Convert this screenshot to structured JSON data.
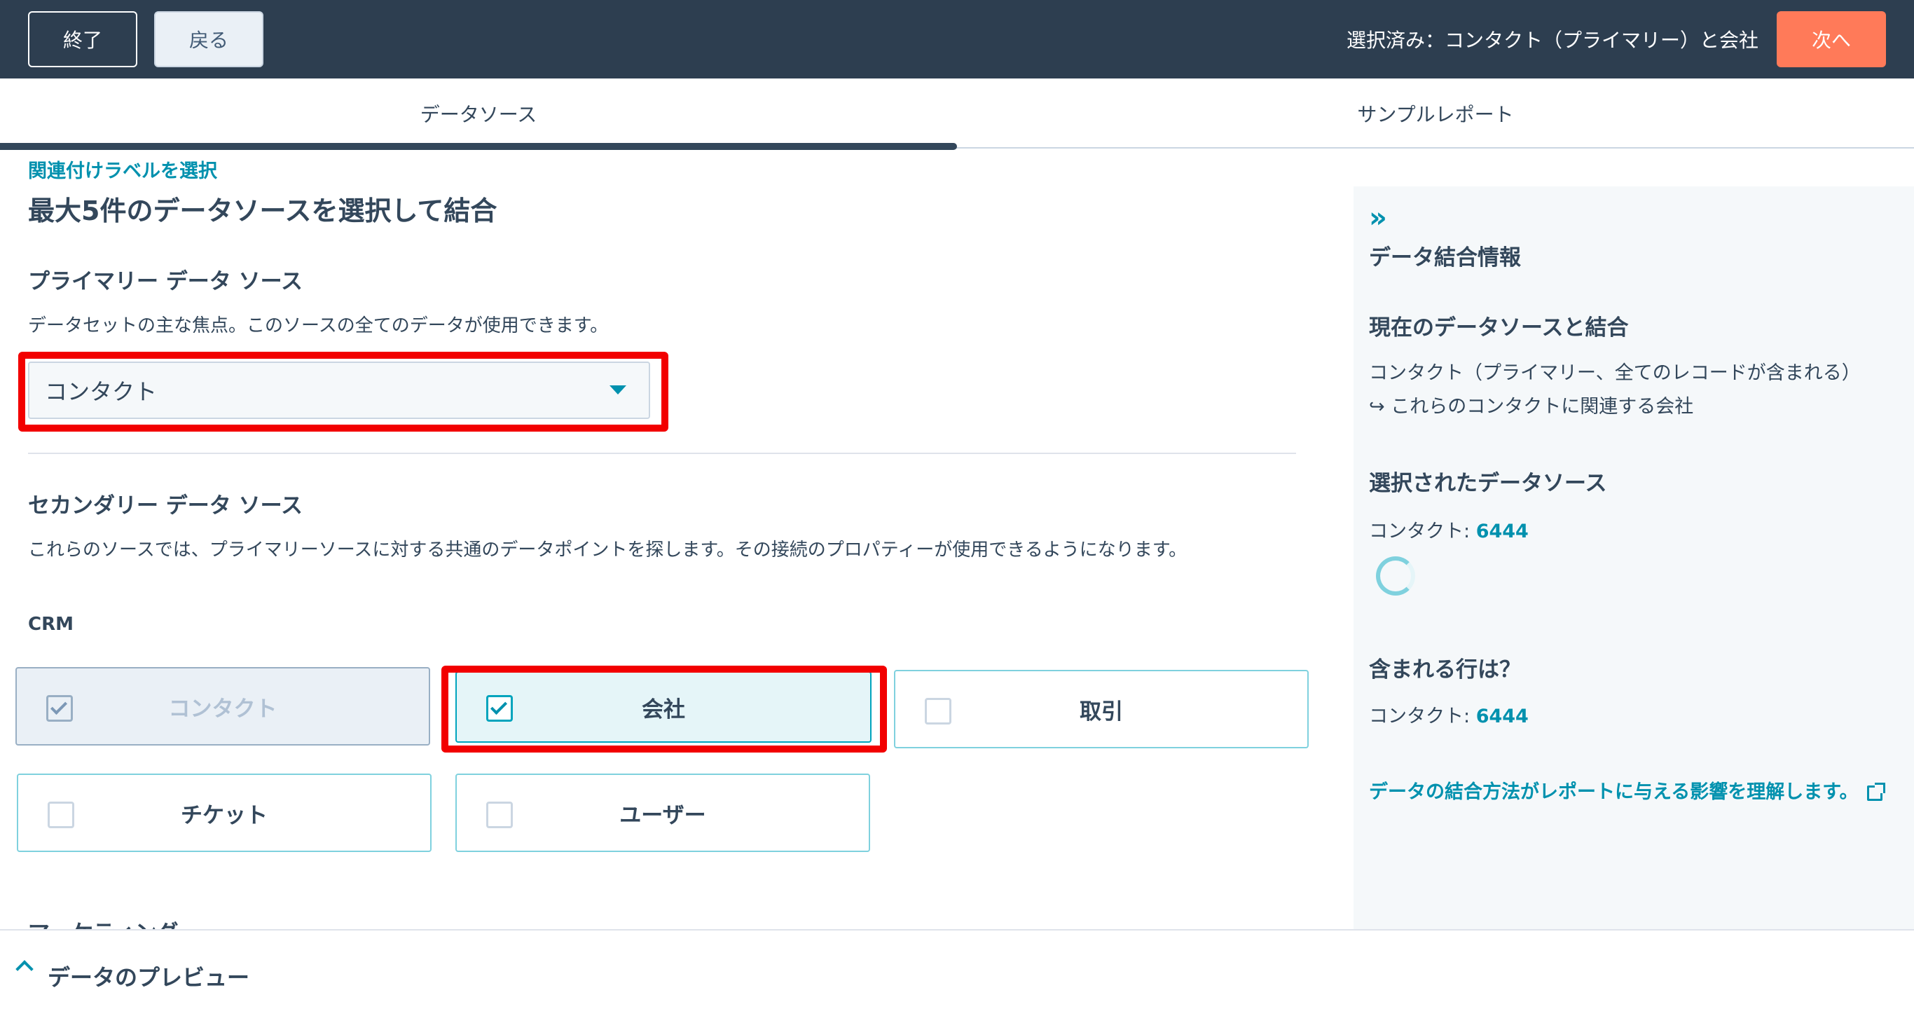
{
  "header": {
    "exit_label": "終了",
    "back_label": "戻る",
    "selected_summary": "選択済み：コンタクト（プライマリー）と会社",
    "next_label": "次へ"
  },
  "tabs": [
    {
      "label": "データソース",
      "active": true
    },
    {
      "label": "サンプルレポート",
      "active": false
    }
  ],
  "main": {
    "link_label": "関連付けラベルを選択",
    "title": "最大5件のデータソースを選択して結合",
    "primary": {
      "title": "プライマリー データ ソース",
      "description": "データセットの主な焦点。このソースの全てのデータが使用できます。",
      "selected_value": "コンタクト"
    },
    "secondary": {
      "title": "セカンダリー データ ソース",
      "description": "これらのソースでは、プライマリーソースに対する共通のデータポイントを探します。その接続のプロパティーが使用できるようになります。"
    },
    "crm_label": "CRM",
    "crm_cards": [
      {
        "label": "コンタクト",
        "checked": true,
        "disabled": true
      },
      {
        "label": "会社",
        "checked": true,
        "disabled": false
      },
      {
        "label": "取引",
        "checked": false,
        "disabled": false
      },
      {
        "label": "チケット",
        "checked": false,
        "disabled": false
      },
      {
        "label": "ユーザー",
        "checked": false,
        "disabled": false
      }
    ],
    "next_section_clipped": "マーケティング"
  },
  "side_panel": {
    "heading": "データ結合情報",
    "current_heading": "現在のデータソースと結合",
    "current_line1": "コンタクト（プライマリー、全てのレコードが含まれる）",
    "current_line2": "↪ これらのコンタクトに関連する会社",
    "selected_heading": "選択されたデータソース",
    "selected_label": "コンタクト: ",
    "selected_count": "6444",
    "rows_heading": "含まれる行は？",
    "rows_label": "コンタクト: ",
    "rows_count": "6444",
    "impact_link": "データの結合方法がレポートに与える影響を理解します。"
  },
  "bottom": {
    "preview_label": "データのプレビュー"
  },
  "colors": {
    "header_bg": "#2d3e50",
    "accent": "#0091ae",
    "next_button": "#ff7a59",
    "highlight": "#f20000"
  },
  "icons": [
    "dropdown-caret-icon",
    "checkbox-check-icon",
    "double-chevron-right-icon",
    "spinner-icon",
    "external-link-icon",
    "chevron-up-icon"
  ]
}
